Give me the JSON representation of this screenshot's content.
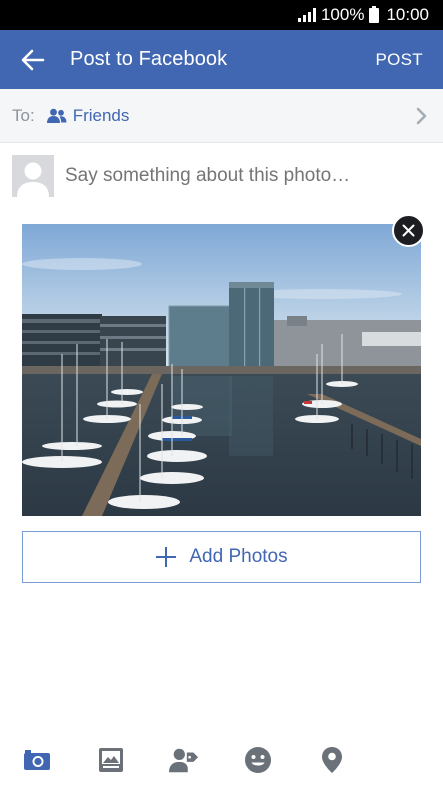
{
  "status_bar": {
    "battery": "100%",
    "time": "10:00"
  },
  "app_bar": {
    "back_icon": "arrow-left-icon",
    "title": "Post to Facebook",
    "post_label": "POST"
  },
  "audience": {
    "to_label": "To:",
    "icon": "friends-icon",
    "value": "Friends",
    "chevron": "chevron-right-icon"
  },
  "composer": {
    "avatar": "default-profile-avatar",
    "placeholder": "Say something about this photo…"
  },
  "photo": {
    "description": "harbor marina photo",
    "remove_icon": "close-icon"
  },
  "add_photos": {
    "label": "Add Photos",
    "icon": "plus-icon"
  },
  "toolbar": {
    "items": [
      "camera-icon",
      "photo-album-icon",
      "tag-people-icon",
      "feeling-icon",
      "location-pin-icon"
    ]
  },
  "colors": {
    "brand": "#4267b2",
    "status_bar": "#000000",
    "placeholder": "#8d949e",
    "icon_gray": "#8d949e"
  }
}
